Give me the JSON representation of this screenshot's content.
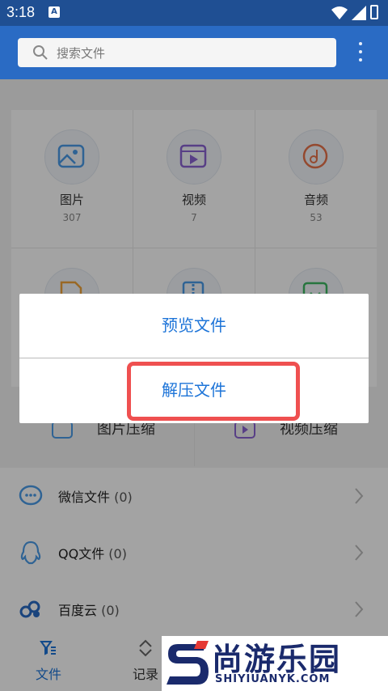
{
  "status_bar": {
    "time": "3:18",
    "notification_letter": "A"
  },
  "search": {
    "placeholder": "搜索文件"
  },
  "categories": [
    {
      "label": "图片",
      "count": "307",
      "icon": "image-icon",
      "color": "#4a9be8"
    },
    {
      "label": "视频",
      "count": "7",
      "icon": "video-icon",
      "color": "#8a63d2"
    },
    {
      "label": "音频",
      "count": "53",
      "icon": "music-icon",
      "color": "#e8734a"
    },
    {
      "icon": "document-icon",
      "color": "#f0a33a"
    },
    {
      "icon": "archive-icon",
      "color": "#4a9be8"
    },
    {
      "icon": "apk-icon",
      "color": "#3eb862"
    }
  ],
  "compress_row": {
    "image_compress": "图片压缩",
    "video_compress": "视频压缩"
  },
  "list": [
    {
      "label": "微信文件",
      "count": "(0)",
      "icon": "wechat-icon"
    },
    {
      "label": "QQ文件",
      "count": "(0)",
      "icon": "qq-icon"
    },
    {
      "label": "百度云",
      "count": "(0)",
      "icon": "baidu-cloud-icon"
    }
  ],
  "bottom_nav": [
    {
      "label": "文件",
      "icon": "filter-files-icon",
      "active": true
    },
    {
      "label": "记录",
      "icon": "sort-icon",
      "active": false
    }
  ],
  "dialog": {
    "preview": "预览文件",
    "extract": "解压文件"
  },
  "watermark": {
    "brand": "尚游乐园",
    "url": "SHIYIUANYK.COM"
  },
  "colors": {
    "header": "#2a6bc4",
    "accent": "#1d74d8",
    "highlight": "#ef5050"
  }
}
